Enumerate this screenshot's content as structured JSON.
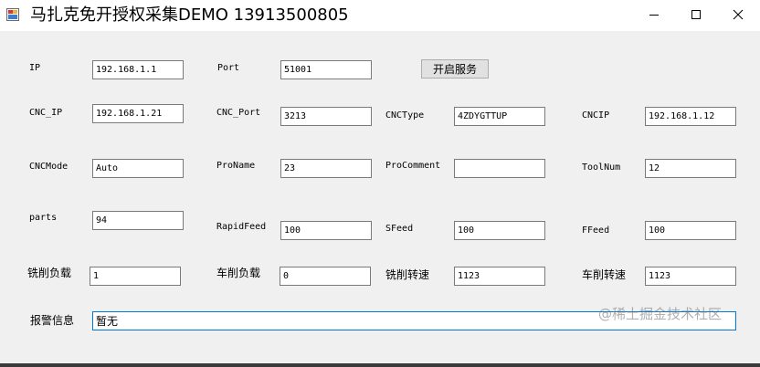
{
  "window": {
    "title": "马扎克免开授权采集DEMO 13913500805"
  },
  "toolbar": {
    "start_service_label": "开启服务"
  },
  "fields": {
    "ip": {
      "label": "IP",
      "value": "192.168.1.1"
    },
    "port": {
      "label": "Port",
      "value": "51001"
    },
    "cnc_ip": {
      "label": "CNC_IP",
      "value": "192.168.1.21"
    },
    "cnc_port": {
      "label": "CNC_Port",
      "value": "3213"
    },
    "cnc_type": {
      "label": "CNCType",
      "value": "4ZDYGTTUP"
    },
    "cncip": {
      "label": "CNCIP",
      "value": "192.168.1.12"
    },
    "cnc_mode": {
      "label": "CNCMode",
      "value": "Auto"
    },
    "pro_name": {
      "label": "ProName",
      "value": "23"
    },
    "pro_comment": {
      "label": "ProComment",
      "value": ""
    },
    "tool_num": {
      "label": "ToolNum",
      "value": "12"
    },
    "parts": {
      "label": "parts",
      "value": "94"
    },
    "rapid_feed": {
      "label": "RapidFeed",
      "value": "100"
    },
    "s_feed": {
      "label": "SFeed",
      "value": "100"
    },
    "f_feed": {
      "label": "FFeed",
      "value": "100"
    },
    "milling_load": {
      "label": "铣削负载",
      "value": "1"
    },
    "turning_load": {
      "label": "车削负载",
      "value": "0"
    },
    "milling_speed": {
      "label": "铣削转速",
      "value": "1123"
    },
    "turning_speed": {
      "label": "车削转速",
      "value": "1123"
    },
    "alarm_info": {
      "label": "报警信息",
      "value": "暂无"
    }
  },
  "watermark": "@稀土掘金技术社区"
}
